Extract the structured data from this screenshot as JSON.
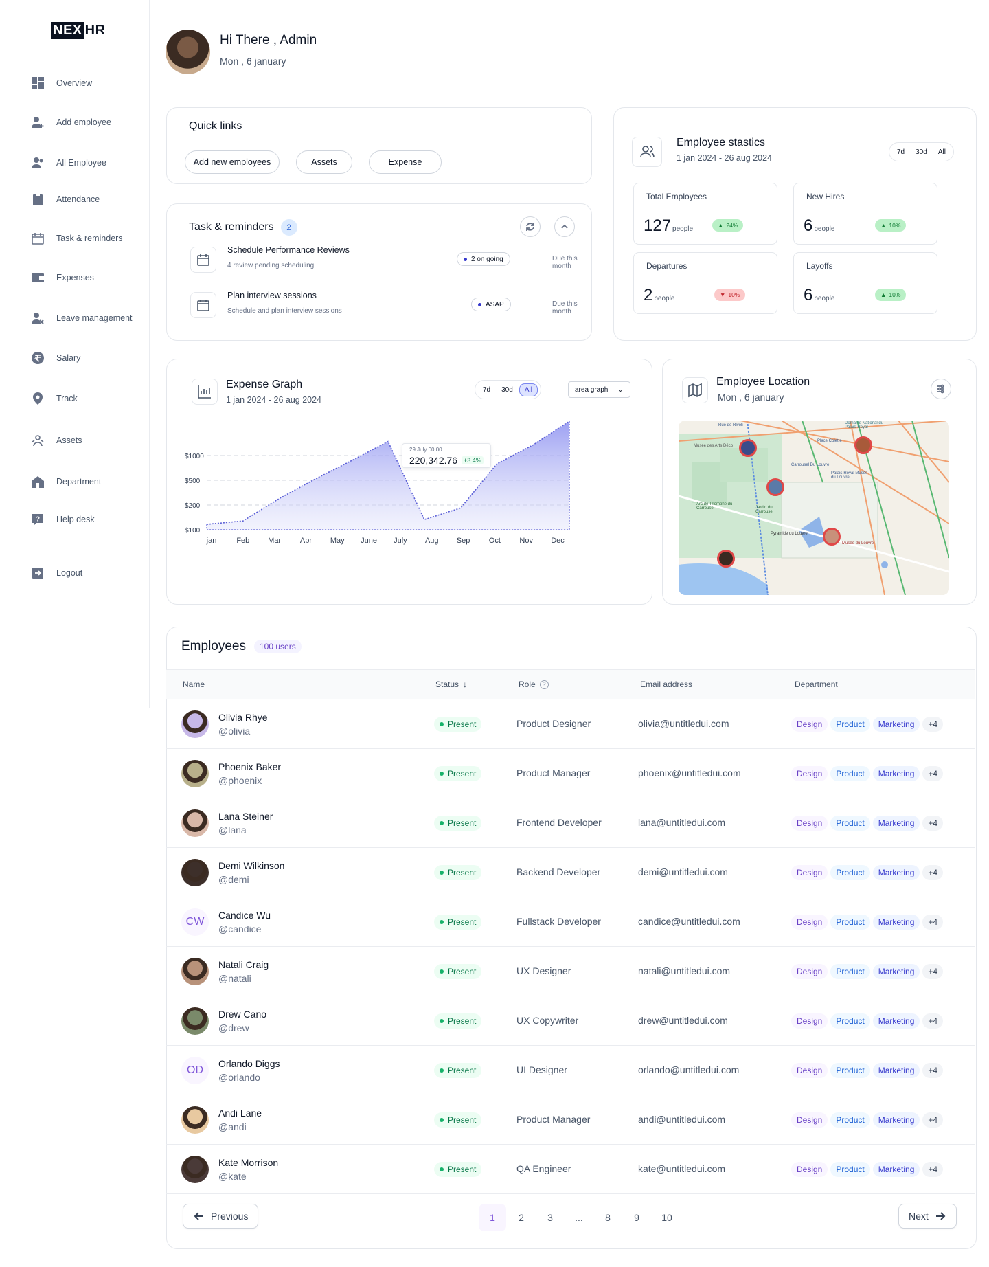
{
  "brand": {
    "part1": "NEX",
    "part2": "HR"
  },
  "sidebar": {
    "items": [
      {
        "label": "Overview",
        "icon": "dashboard-icon"
      },
      {
        "label": "Add employee",
        "icon": "add-user-icon"
      },
      {
        "label": "All Employee",
        "icon": "users-icon"
      },
      {
        "label": "Attendance",
        "icon": "clipboard-icon"
      },
      {
        "label": "Task & reminders",
        "icon": "calendar-icon"
      },
      {
        "label": "Expenses",
        "icon": "wallet-icon"
      },
      {
        "label": "Leave management",
        "icon": "user-remove-icon"
      },
      {
        "label": "Salary",
        "icon": "rupee-icon"
      },
      {
        "label": "Track",
        "icon": "location-pin-icon"
      },
      {
        "label": "Assets",
        "icon": "assets-icon"
      },
      {
        "label": "Department",
        "icon": "building-icon"
      },
      {
        "label": "Help desk",
        "icon": "help-icon"
      },
      {
        "label": "Logout",
        "icon": "logout-icon"
      }
    ]
  },
  "header": {
    "greeting": "Hi There , Admin",
    "date": "Mon , 6 january"
  },
  "quick_links": {
    "title": "Quick links",
    "buttons": [
      "Add new employees",
      "Assets",
      "Expense"
    ]
  },
  "tasks": {
    "title": "Task & reminders",
    "count": "2",
    "items": [
      {
        "name": "Schedule Performance Reviews",
        "sub": "4 review pending scheduling",
        "status": "2 on going",
        "due": "Due this month"
      },
      {
        "name": "Plan interview sessions",
        "sub": "Schedule and plan interview sessions",
        "status": "ASAP",
        "due": "Due this month"
      }
    ]
  },
  "stats": {
    "title": "Employee stastics",
    "range": "1 jan 2024 - 26 aug 2024",
    "filters": [
      "7d",
      "30d",
      "All"
    ],
    "boxes": [
      {
        "label": "Total Employees",
        "value": "127",
        "unit": "people",
        "change": "24%",
        "dir": "up"
      },
      {
        "label": "New Hires",
        "value": "6",
        "unit": "people",
        "change": "10%",
        "dir": "up"
      },
      {
        "label": "Departures",
        "value": "2",
        "unit": "people",
        "change": "10%",
        "dir": "down"
      },
      {
        "label": "Layoffs",
        "value": "6",
        "unit": "people",
        "change": "10%",
        "dir": "up"
      }
    ]
  },
  "expense": {
    "title": "Expense Graph",
    "range": "1 jan 2024 - 26 aug 2024",
    "filters": [
      "7d",
      "30d",
      "All"
    ],
    "active_filter": "All",
    "graph_type": "area graph",
    "tooltip": {
      "date": "29 July 00:00",
      "value": "220,342.76",
      "change": "+3.4%"
    }
  },
  "chart_data": {
    "type": "area",
    "categories": [
      "jan",
      "Feb",
      "Mar",
      "Apr",
      "May",
      "June",
      "July",
      "Aug",
      "Sep",
      "Oct",
      "Nov",
      "Dec"
    ],
    "y_ticks": [
      "$100",
      "$200",
      "$500",
      "$1000"
    ],
    "values": [
      180,
      230,
      560,
      850,
      1120,
      1400,
      250,
      420,
      1070,
      1350,
      1700
    ],
    "ylim": [
      100,
      1720
    ],
    "grid": true,
    "color": "#5b5fd6"
  },
  "location": {
    "title": "Employee Location",
    "date": "Mon , 6 january",
    "map_labels": [
      "Rue de Rivoli",
      "Musée des Arts Déco",
      "Domaine National du Palais-Royal",
      "Place Colette",
      "Carrousel Du Louvre",
      "Palais-Royal Musée du Louvre",
      "Arc de Triomphe du Carrousel",
      "Jardin du Carrousel",
      "Pyramide du Louvre",
      "Musée du Louvre"
    ]
  },
  "employees": {
    "title": "Employees",
    "count": "100 users",
    "columns": [
      "Name",
      "Status",
      "Role",
      "Email address",
      "Department"
    ],
    "rows": [
      {
        "name": "Olivia Rhye",
        "handle": "@olivia",
        "status": "Present",
        "role": "Product Designer",
        "email": "olivia@untitledui.com",
        "initials": "",
        "avatar_color": "#c7b8e8"
      },
      {
        "name": "Phoenix Baker",
        "handle": "@phoenix",
        "status": "Present",
        "role": "Product Manager",
        "email": "phoenix@untitledui.com",
        "initials": "",
        "avatar_color": "#b8b08a"
      },
      {
        "name": "Lana Steiner",
        "handle": "@lana",
        "status": "Present",
        "role": "Frontend Developer",
        "email": "lana@untitledui.com",
        "initials": "",
        "avatar_color": "#d9b8a8"
      },
      {
        "name": "Demi Wilkinson",
        "handle": "@demi",
        "status": "Present",
        "role": "Backend Developer",
        "email": "demi@untitledui.com",
        "initials": "",
        "avatar_color": "#3d2f2a"
      },
      {
        "name": "Candice Wu",
        "handle": "@candice",
        "status": "Present",
        "role": "Fullstack Developer",
        "email": "candice@untitledui.com",
        "initials": "CW",
        "avatar_color": "#f9f5ff"
      },
      {
        "name": "Natali Craig",
        "handle": "@natali",
        "status": "Present",
        "role": "UX Designer",
        "email": "natali@untitledui.com",
        "initials": "",
        "avatar_color": "#b8927a"
      },
      {
        "name": "Drew Cano",
        "handle": "@drew",
        "status": "Present",
        "role": "UX Copywriter",
        "email": "drew@untitledui.com",
        "initials": "",
        "avatar_color": "#7a8a6a"
      },
      {
        "name": "Orlando Diggs",
        "handle": "@orlando",
        "status": "Present",
        "role": "UI Designer",
        "email": "orlando@untitledui.com",
        "initials": "OD",
        "avatar_color": "#f9f5ff"
      },
      {
        "name": "Andi Lane",
        "handle": "@andi",
        "status": "Present",
        "role": "Product Manager",
        "email": "andi@untitledui.com",
        "initials": "",
        "avatar_color": "#e8c9a0"
      },
      {
        "name": "Kate Morrison",
        "handle": "@kate",
        "status": "Present",
        "role": "QA Engineer",
        "email": "kate@untitledui.com",
        "initials": "",
        "avatar_color": "#4a3a38"
      }
    ],
    "tags": [
      "Design",
      "Product",
      "Marketing",
      "+4"
    ]
  },
  "pagination": {
    "prev": "Previous",
    "next": "Next",
    "pages": [
      "1",
      "2",
      "3",
      "...",
      "8",
      "9",
      "10"
    ],
    "active": "1"
  }
}
